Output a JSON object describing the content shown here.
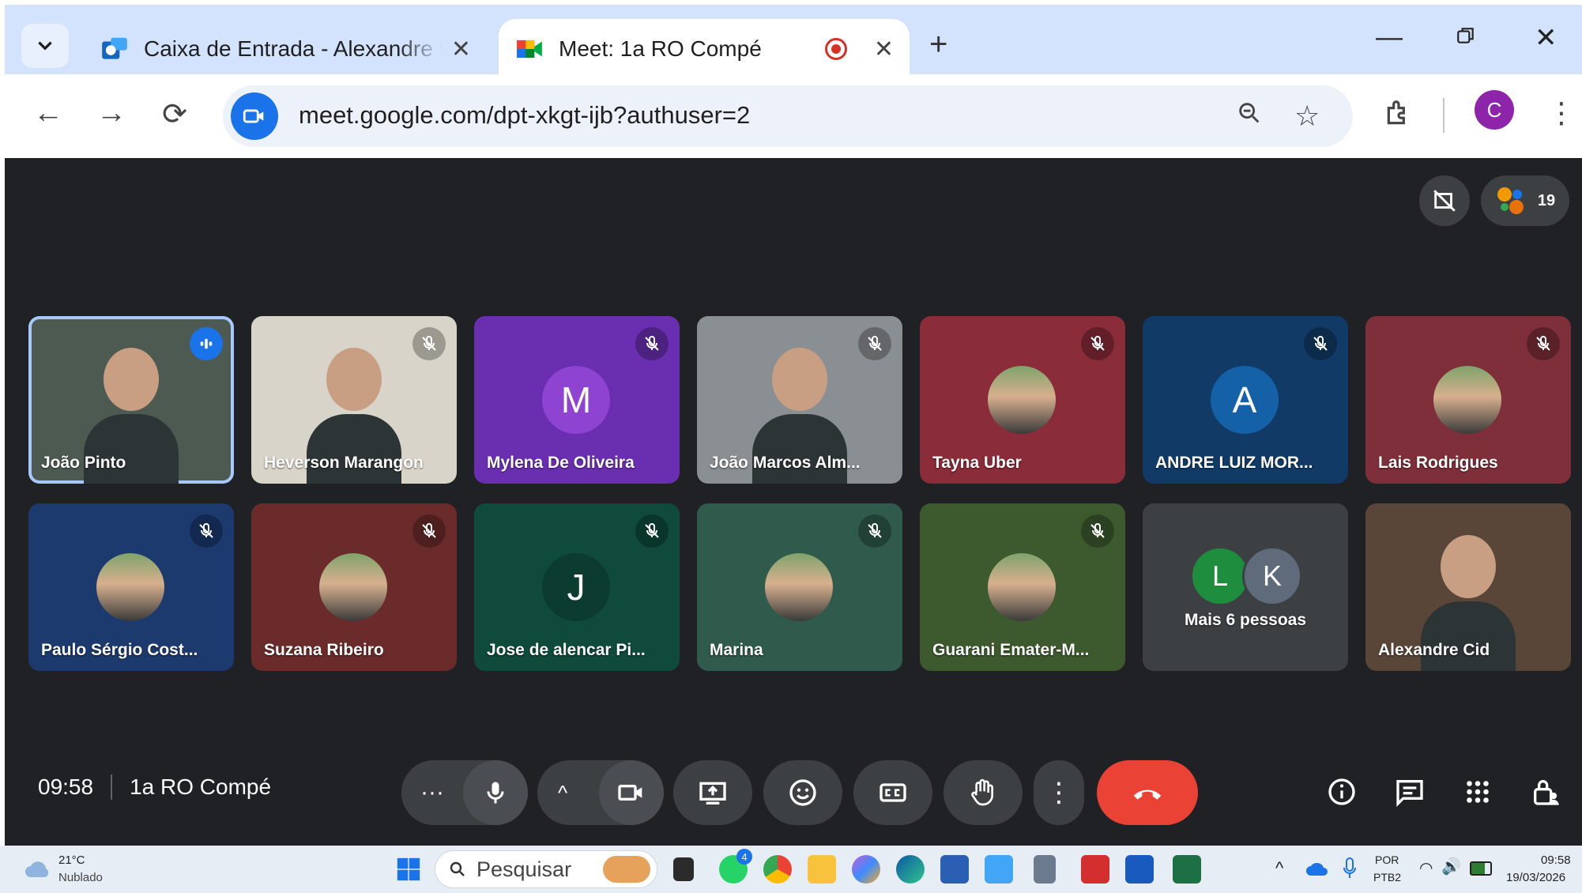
{
  "browser": {
    "tabs": [
      {
        "title": "Caixa de Entrada - Alexandre Ci",
        "active": false
      },
      {
        "title": "Meet: 1a RO Compé",
        "active": true
      }
    ],
    "url": "meet.google.com/dpt-xkgt-ijb?authuser=2",
    "profile_initial": "C"
  },
  "meet": {
    "participant_count": "19",
    "time": "09:58",
    "meeting_name": "1a RO Compé",
    "participants": [
      {
        "name": "João Pinto",
        "kind": "video",
        "bg": "#4d5a52",
        "muted": false,
        "speaking": true
      },
      {
        "name": "Heverson Marangon",
        "kind": "video",
        "bg": "#d9d4c9",
        "muted": true
      },
      {
        "name": "Mylena De Oliveira",
        "kind": "letter",
        "letter": "M",
        "bg": "#6a2fb0",
        "avatar": "#8e44d0",
        "muted": true
      },
      {
        "name": "João Marcos Alm...",
        "kind": "video",
        "bg": "#8a8f93",
        "muted": true
      },
      {
        "name": "Tayna Uber",
        "kind": "photo",
        "bg": "#8a2c39",
        "muted": true
      },
      {
        "name": "ANDRE LUIZ MOR...",
        "kind": "letter",
        "letter": "A",
        "bg": "#113b66",
        "avatar": "#1561a8",
        "muted": true
      },
      {
        "name": "Lais Rodrigues",
        "kind": "photo",
        "bg": "#7e2f3a",
        "muted": true
      },
      {
        "name": "Paulo Sérgio Cost...",
        "kind": "photo",
        "bg": "#1d3a6e",
        "muted": true
      },
      {
        "name": "Suzana Ribeiro",
        "kind": "photo",
        "bg": "#6b2b2b",
        "muted": true
      },
      {
        "name": "Jose de alencar Pi...",
        "kind": "letter",
        "letter": "J",
        "bg": "#0f4a3b",
        "avatar": "#0c3b2f",
        "muted": true
      },
      {
        "name": "Marina",
        "kind": "photo",
        "bg": "#2f5a4c",
        "muted": true
      },
      {
        "name": "Guarani Emater-M...",
        "kind": "photo",
        "bg": "#3d5a2e",
        "muted": true
      },
      {
        "name": "Mais 6 pessoas",
        "kind": "more",
        "bg": "#3c4043",
        "letters": [
          "L",
          "K"
        ]
      },
      {
        "name": "Alexandre Cid",
        "kind": "video",
        "bg": "#5a4638",
        "muted": false
      }
    ]
  },
  "taskbar": {
    "temperature": "21°C",
    "weather": "Nublado",
    "search_placeholder": "Pesquisar",
    "whatsapp_badge": "4",
    "lang_top": "POR",
    "lang_bottom": "PTB2",
    "clock_time": "09:58",
    "clock_date": "19/03/2026"
  }
}
